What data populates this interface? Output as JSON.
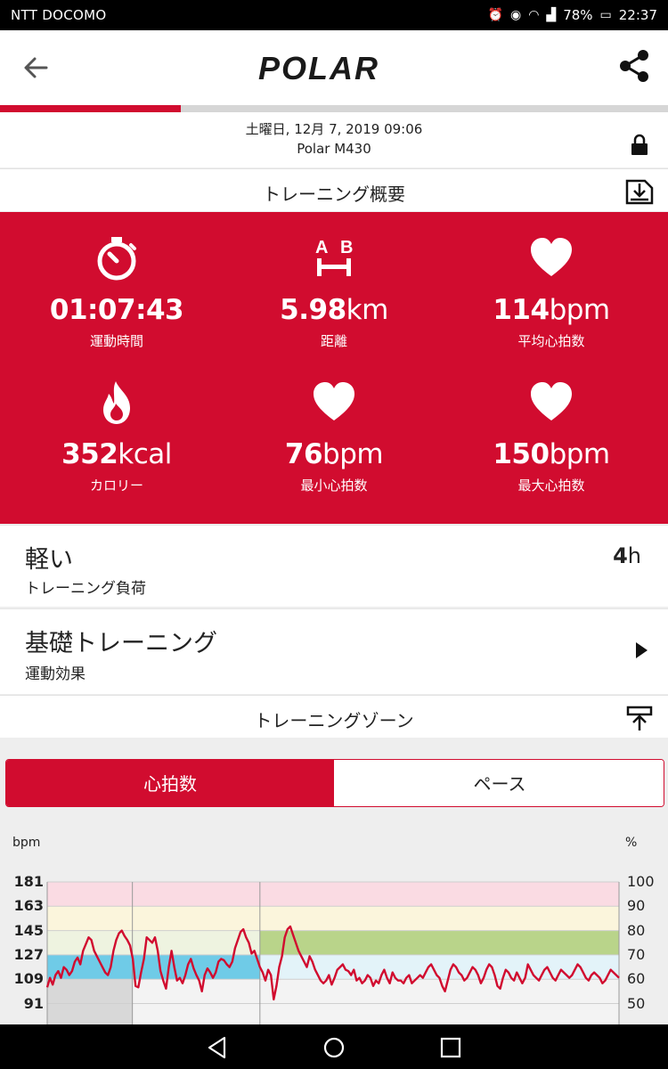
{
  "status_bar": {
    "carrier": "NTT DOCOMO",
    "battery": "78%",
    "time": "22:37"
  },
  "header": {
    "logo_text": "POLAR"
  },
  "progress_fraction": 0.27,
  "session": {
    "date": "土曜日, 12月 7, 2019 09:06",
    "device": "Polar M430"
  },
  "summary_section": {
    "title": "トレーニング概要"
  },
  "summary": {
    "duration": {
      "value": "01:07:43",
      "unit": "",
      "label": "運動時間",
      "icon": "stopwatch-icon"
    },
    "distance": {
      "value": "5.98",
      "unit": "km",
      "label": "距離",
      "icon": "distance-ab-icon"
    },
    "avg_hr": {
      "value": "114",
      "unit": "bpm",
      "label": "平均心拍数",
      "icon": "heart-icon"
    },
    "calories": {
      "value": "352",
      "unit": "kcal",
      "label": "カロリー",
      "icon": "flame-icon"
    },
    "min_hr": {
      "value": "76",
      "unit": "bpm",
      "label": "最小心拍数",
      "icon": "heart-icon"
    },
    "max_hr": {
      "value": "150",
      "unit": "bpm",
      "label": "最大心拍数",
      "icon": "heart-icon"
    }
  },
  "training_load": {
    "level": "軽い",
    "label": "トレーニング負荷",
    "recovery_value": "4",
    "recovery_unit": "h"
  },
  "training_benefit": {
    "title": "基礎トレーニング",
    "label": "運動効果"
  },
  "zones_section": {
    "title": "トレーニングゾーン"
  },
  "tabs": {
    "active": "心拍数",
    "inactive": "ペース"
  },
  "colors": {
    "brand_red": "#d10c2f",
    "zone5": "#fadbe3",
    "zone4": "#fbf5dc",
    "zone3": "#eef3e0",
    "zone2": "#e3f3f9",
    "zone1": "#f3f3f3",
    "zone3_active": "#b9d48a",
    "zone2_active": "#6fcbe7",
    "zone1_active": "#d8d8d8"
  },
  "chart_data": {
    "type": "line",
    "left_axis_label": "bpm",
    "right_axis_label": "%",
    "left_ticks": [
      181,
      163,
      145,
      127,
      109,
      91
    ],
    "right_ticks": [
      100,
      90,
      80,
      70,
      60,
      50
    ],
    "ylim": [
      91,
      181
    ],
    "zone_bounds_bpm": [
      181,
      163,
      145,
      127,
      109,
      91
    ],
    "lap_marker_fractions": [
      0.149,
      0.372
    ],
    "series": [
      {
        "values": [
          103,
          110,
          105,
          112,
          115,
          110,
          118,
          116,
          112,
          115,
          122,
          125,
          120,
          130,
          135,
          140,
          138,
          130,
          126,
          122,
          118,
          114,
          112,
          118,
          130,
          138,
          143,
          145,
          141,
          138,
          134,
          124,
          104,
          103,
          114,
          124,
          140,
          138,
          136,
          140,
          130,
          115,
          108,
          102,
          118,
          130,
          118,
          108,
          110,
          106,
          112,
          120,
          124,
          117,
          112,
          108,
          100,
          112,
          117,
          114,
          110,
          114,
          122,
          124,
          123,
          120,
          118,
          122,
          132,
          138,
          144,
          146,
          140,
          136,
          128,
          130,
          124,
          118,
          114,
          108,
          116,
          112,
          94,
          104,
          118,
          126,
          140,
          146,
          148,
          142,
          136,
          130,
          126,
          122,
          118,
          126,
          122,
          116,
          112,
          108,
          106,
          108,
          112,
          105,
          110,
          116,
          118,
          120,
          116,
          115,
          112,
          116,
          108,
          110,
          106,
          108,
          112,
          110,
          104,
          108,
          106,
          112,
          116,
          110,
          106,
          114,
          110,
          108,
          108,
          106,
          110,
          112,
          106,
          108,
          110,
          112,
          110,
          114,
          118,
          120,
          116,
          112,
          110,
          104,
          100,
          108,
          116,
          120,
          118,
          114,
          112,
          108,
          110,
          114,
          118,
          116,
          112,
          106,
          110,
          116,
          120,
          118,
          112,
          104,
          102,
          110,
          116,
          114,
          110,
          108,
          114,
          110,
          106,
          110,
          120,
          116,
          112,
          110,
          108,
          112,
          116,
          118,
          114,
          110,
          108,
          112,
          116,
          114,
          112,
          110,
          112,
          116,
          120,
          118,
          114,
          110,
          108,
          112,
          114,
          112,
          110,
          106,
          108,
          112,
          116,
          114,
          112,
          110
        ]
      }
    ]
  }
}
